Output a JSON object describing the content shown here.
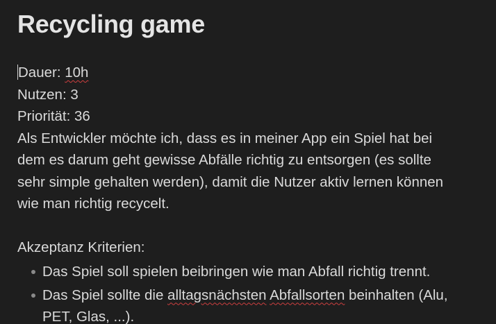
{
  "note": {
    "title": "Recycling game",
    "meta": {
      "duration_label": "Dauer: ",
      "duration_value": "10h",
      "benefit": "Nutzen: 3",
      "priority": "Priorität: 36"
    },
    "story_lines": [
      "Als Entwickler möchte ich, dass es in meiner App ein Spiel hat bei",
      "dem es darum geht gewisse Abfälle richtig zu entsorgen (es sollte",
      "sehr simple gehalten werden), damit die Nutzer aktiv lernen können",
      "wie man richtig recycelt."
    ],
    "criteria_heading": "Akzeptanz Kriterien:",
    "criteria": {
      "item1": "Das Spiel soll spielen beibringen wie man Abfall richtig trennt.",
      "item2_pre": "Das Spiel sollte die ",
      "item2_word1": "alltagsnächsten",
      "item2_space": " ",
      "item2_word2": "Abfallsorten",
      "item2_post": " beinhalten (Alu,",
      "item2_line2": "PET, Glas, ...)."
    }
  }
}
